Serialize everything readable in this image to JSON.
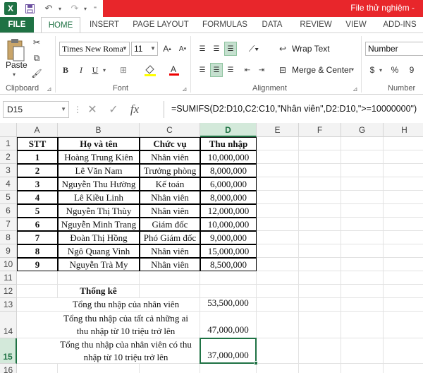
{
  "window": {
    "title": "File thử nghiệm -"
  },
  "quick_access": {
    "app_icon": "excel-logo-icon",
    "app_letter": "X",
    "save_icon": "save-icon",
    "undo_icon": "undo-icon",
    "redo_icon": "redo-icon"
  },
  "tabs": [
    "FILE",
    "HOME",
    "INSERT",
    "PAGE LAYOUT",
    "FORMULAS",
    "DATA",
    "REVIEW",
    "VIEW",
    "ADD-INS"
  ],
  "ribbon": {
    "paste_label": "Paste",
    "clipboard_label": "Clipboard",
    "font_name": "Times New Roma",
    "font_size": "11",
    "font_label": "Font",
    "bold": "B",
    "italic": "I",
    "underline": "U",
    "wrap_text": "Wrap Text",
    "merge_center": "Merge & Center",
    "alignment_label": "Alignment",
    "number_format": "Number",
    "number_label": "Number",
    "currency": "$",
    "percent": "%",
    "comma": "9"
  },
  "formula_bar": {
    "name_box": "D15",
    "formula": "=SUMIFS(D2:D10,C2:C10,\"Nhân viên\",D2:D10,\">=10000000\")"
  },
  "grid": {
    "columns": [
      "A",
      "B",
      "C",
      "D",
      "E",
      "F",
      "G",
      "H"
    ],
    "rows": [
      "1",
      "2",
      "3",
      "4",
      "5",
      "6",
      "7",
      "8",
      "9",
      "10",
      "11",
      "12",
      "13",
      "14",
      "15",
      "16"
    ],
    "headers": {
      "stt": "STT",
      "name": "Họ và tên",
      "position": "Chức vụ",
      "income": "Thu nhập"
    },
    "employees": [
      {
        "stt": "1",
        "name": "Hoàng Trung Kiên",
        "position": "Nhân viên",
        "income": "10,000,000"
      },
      {
        "stt": "2",
        "name": "Lê Văn Nam",
        "position": "Trưởng phòng",
        "income": "8,000,000"
      },
      {
        "stt": "3",
        "name": "Nguyễn Thu Hường",
        "position": "Kế toán",
        "income": "6,000,000"
      },
      {
        "stt": "4",
        "name": "Lê Kiều Linh",
        "position": "Nhân viên",
        "income": "8,000,000"
      },
      {
        "stt": "5",
        "name": "Nguyễn Thị Thùy",
        "position": "Nhân viên",
        "income": "12,000,000"
      },
      {
        "stt": "6",
        "name": "Nguyễn Minh Trang",
        "position": "Giám đốc",
        "income": "10,000,000"
      },
      {
        "stt": "7",
        "name": "Đoàn Thị Hồng",
        "position": "Phó Giám đốc",
        "income": "9,000,000"
      },
      {
        "stt": "8",
        "name": "Ngô Quang Vinh",
        "position": "Nhân viên",
        "income": "15,000,000"
      },
      {
        "stt": "9",
        "name": "Nguyễn Trà My",
        "position": "Nhân viên",
        "income": "8,500,000"
      }
    ],
    "stats_title": "Thống kê",
    "stats": [
      {
        "label": "Tổng thu nhập của nhân viên",
        "value": "53,500,000"
      },
      {
        "label": "Tổng thu nhập của tất cả những ai thu nhập từ 10 triệu trở lên",
        "value": "47,000,000"
      },
      {
        "label": "Tổng thu nhập của nhân viên có thu nhập từ 10 triệu trở lên",
        "value": "37,000,000"
      }
    ],
    "selected_cell": "D15",
    "selected_column": "D",
    "selected_row": "15"
  },
  "colors": {
    "excel_green": "#1f7244",
    "title_red": "#e8262b"
  }
}
